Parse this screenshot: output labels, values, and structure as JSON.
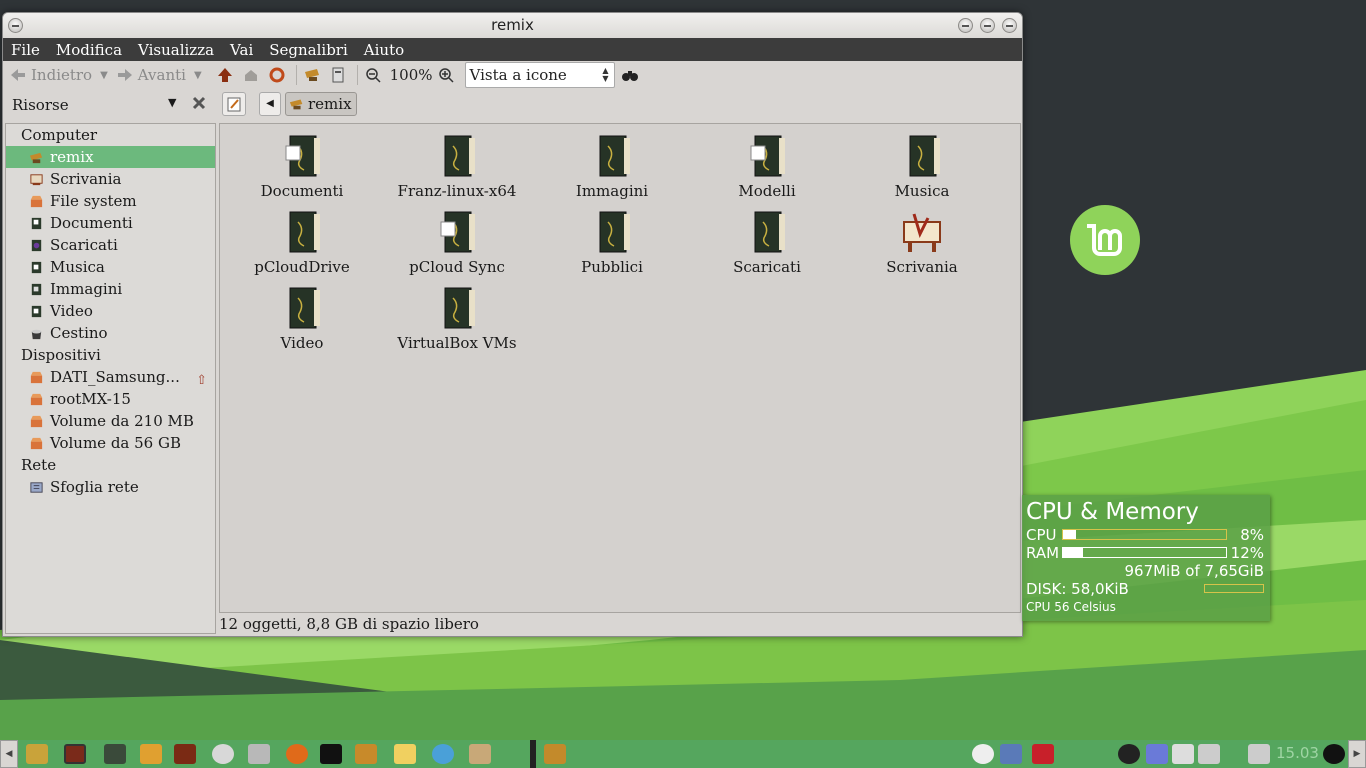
{
  "window": {
    "title": "remix"
  },
  "menu": [
    "File",
    "Modifica",
    "Visualizza",
    "Vai",
    "Segnalibri",
    "Aiuto"
  ],
  "toolbar": {
    "back_label": "Indietro",
    "forward_label": "Avanti",
    "zoom_level": "100%",
    "view_mode": "Vista a icone"
  },
  "location": {
    "side_pane_title": "Risorse",
    "crumb": "remix"
  },
  "sidebar": {
    "computer_header": "Computer",
    "computer_items": [
      "remix",
      "Scrivania",
      "File system",
      "Documenti",
      "Scaricati",
      "Musica",
      "Immagini",
      "Video",
      "Cestino"
    ],
    "devices_header": "Dispositivi",
    "devices_items": [
      "DATI_Samsung...",
      "rootMX-15",
      "Volume da 210 MB",
      "Volume da 56 GB"
    ],
    "network_header": "Rete",
    "network_items": [
      "Sfoglia rete"
    ]
  },
  "files": [
    "Documenti",
    "Franz-linux-x64",
    "Immagini",
    "Modelli",
    "Musica",
    "pCloudDrive",
    "pCloud Sync",
    "Pubblici",
    "Scaricati",
    "Scrivania",
    "Video",
    "VirtualBox VMs"
  ],
  "status": "12 oggetti, 8,8 GB di spazio libero",
  "conky": {
    "title": "CPU & Memory",
    "cpu_label": "CPU",
    "cpu_pct": "8%",
    "cpu_value": 0.08,
    "ram_label": "RAM",
    "ram_pct": "12%",
    "ram_value": 0.12,
    "mem_usage": "967MiB of 7,65GiB",
    "disk": "DISK: 58,0KiB",
    "temp": "CPU 56 Celsius"
  },
  "taskbar": {
    "clock": "15.03"
  },
  "colors": {
    "accent_green": "#6cb97d",
    "menubar": "#3c3c3c",
    "taskbar": "#55a65e"
  }
}
